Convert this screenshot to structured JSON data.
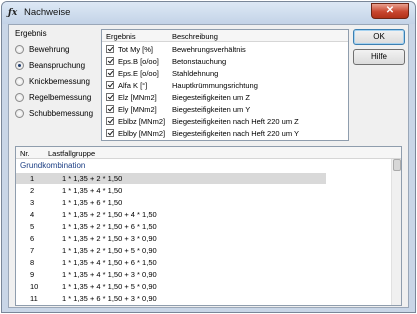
{
  "window": {
    "title": "Nachweise",
    "app_icon": "fx-app-icon",
    "close_label": "✕"
  },
  "ergebnis_group": {
    "label": "Ergebnis",
    "options": [
      {
        "label": "Bewehrung",
        "checked": false
      },
      {
        "label": "Beanspruchung",
        "checked": true
      },
      {
        "label": "Knickbemessung",
        "checked": false
      },
      {
        "label": "Regelbemessung",
        "checked": false
      },
      {
        "label": "Schubbemessung",
        "checked": false
      }
    ]
  },
  "results": {
    "headers": [
      "Ergebnis",
      "Beschreibung"
    ],
    "rows": [
      {
        "code": "Tot My [%]",
        "desc": "Bewehrungsverhältnis",
        "checked": true
      },
      {
        "code": "Eps.B [o/oo]",
        "desc": "Betonstauchung",
        "checked": true
      },
      {
        "code": "Eps.E [o/oo]",
        "desc": "Stahldehnung",
        "checked": true
      },
      {
        "code": "Alfa K [°]",
        "desc": "Hauptkrümmungsrichtung",
        "checked": true
      },
      {
        "code": "Elz [MNm2]",
        "desc": "Biegesteifigkeiten um Z",
        "checked": true
      },
      {
        "code": "Ely [MNm2]",
        "desc": "Biegesteifigkeiten um Y",
        "checked": true
      },
      {
        "code": "Eblbz [MNm2]",
        "desc": "Biegesteifigkeiten nach Heft 220 um Z",
        "checked": true
      },
      {
        "code": "Eblby [MNm2]",
        "desc": "Biegesteifigkeiten nach Heft 220 um Y",
        "checked": true
      }
    ]
  },
  "buttons": {
    "ok": "OK",
    "help": "Hilfe"
  },
  "lastfall": {
    "headers": [
      "Nr.",
      "Lastfallgruppe"
    ],
    "group_title": "Grundkombination",
    "rows": [
      {
        "nr": "1",
        "value": "1 * 1,35 + 2 * 1,50",
        "selected": true
      },
      {
        "nr": "2",
        "value": "1 * 1,35 + 4 * 1,50",
        "selected": false
      },
      {
        "nr": "3",
        "value": "1 * 1,35 + 6 * 1,50",
        "selected": false
      },
      {
        "nr": "4",
        "value": "1 * 1,35 + 2 * 1,50 + 4 * 1,50",
        "selected": false
      },
      {
        "nr": "5",
        "value": "1 * 1,35 + 2 * 1,50 + 6 * 1,50",
        "selected": false
      },
      {
        "nr": "6",
        "value": "1 * 1,35 + 2 * 1,50 + 3 * 0,90",
        "selected": false
      },
      {
        "nr": "7",
        "value": "1 * 1,35 + 2 * 1,50 + 5 * 0,90",
        "selected": false
      },
      {
        "nr": "8",
        "value": "1 * 1,35 + 4 * 1,50 + 6 * 1,50",
        "selected": false
      },
      {
        "nr": "9",
        "value": "1 * 1,35 + 4 * 1,50 + 3 * 0,90",
        "selected": false
      },
      {
        "nr": "10",
        "value": "1 * 1,35 + 4 * 1,50 + 5 * 0,90",
        "selected": false
      },
      {
        "nr": "11",
        "value": "1 * 1,35 + 6 * 1,50 + 3 * 0,90",
        "selected": false
      }
    ]
  }
}
